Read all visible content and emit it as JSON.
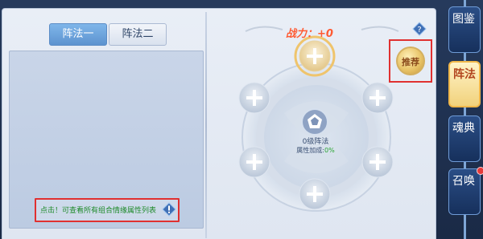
{
  "tabs": [
    {
      "label": "阵法一",
      "active": true
    },
    {
      "label": "阵法二",
      "active": false
    }
  ],
  "hint": {
    "text": "点击！可查看所有组合情缘属性列表",
    "icon": "info-diamond-icon"
  },
  "right": {
    "power_label": "战力：+0",
    "help_icon": "question-diamond-icon",
    "recommend_label": "推荐",
    "slots": [
      {
        "name": "slot-top",
        "icon": "plus-icon",
        "highlight": true
      },
      {
        "name": "slot-upper-left",
        "icon": "plus-icon",
        "highlight": false
      },
      {
        "name": "slot-upper-right",
        "icon": "plus-icon",
        "highlight": false
      },
      {
        "name": "slot-lower-left",
        "icon": "plus-icon",
        "highlight": false
      },
      {
        "name": "slot-lower-right",
        "icon": "plus-icon",
        "highlight": false
      },
      {
        "name": "slot-bottom",
        "icon": "plus-icon",
        "highlight": false
      }
    ],
    "center": {
      "icon": "pentagon-emblem-icon",
      "level_label": "0级阵法",
      "bonus_label": "属性加成:",
      "bonus_value": "0%"
    }
  },
  "side_menu": {
    "items": [
      {
        "label": "图鉴",
        "active": false,
        "badge": false
      },
      {
        "label": "阵法",
        "active": true,
        "badge": false
      },
      {
        "label": "魂典",
        "active": false,
        "badge": false
      },
      {
        "label": "召唤",
        "active": false,
        "badge": true
      }
    ]
  },
  "colors": {
    "active_tab": "#5d93cf",
    "hint_text": "#1e8a2a",
    "power_text": "#ff5a32",
    "bonus_value": "#2aa632",
    "highlight_box": "#e03030"
  }
}
